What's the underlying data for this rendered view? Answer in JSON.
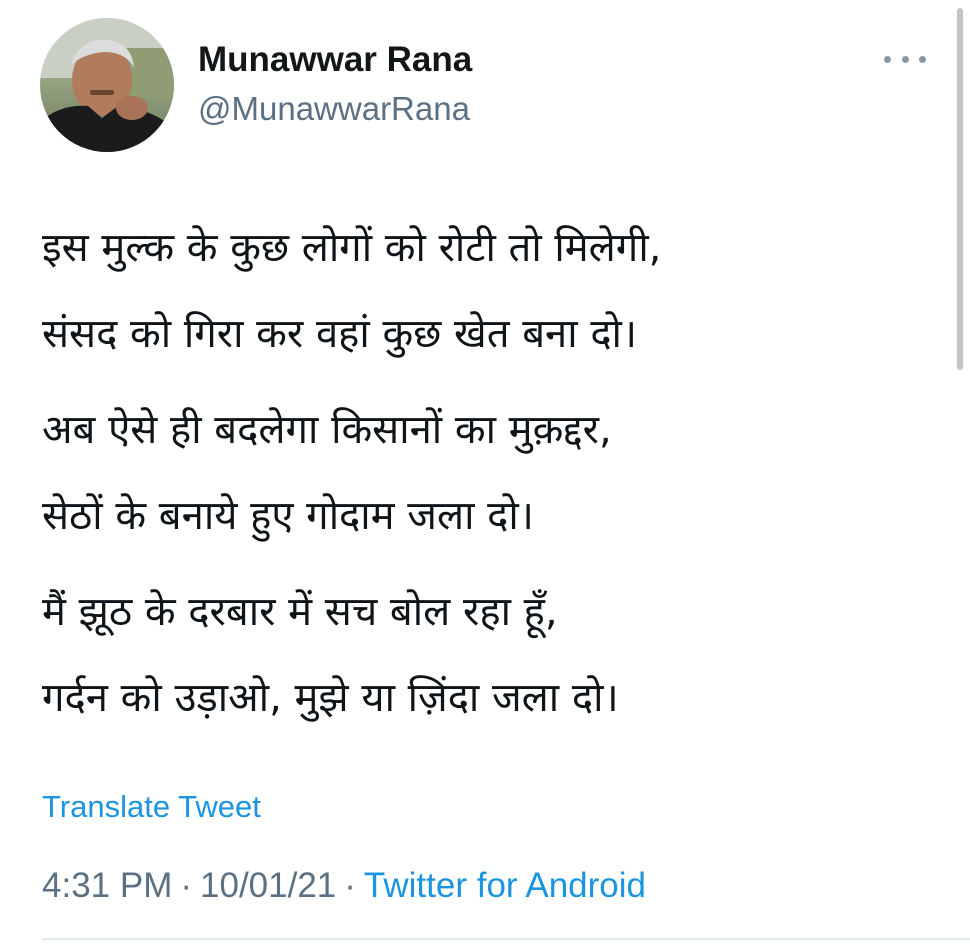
{
  "author": {
    "name": "Munawwar Rana",
    "handle": "@MunawwarRana",
    "avatar_icon": "profile-photo"
  },
  "tweet": {
    "stanzas": [
      [
        "इस मुल्क के कुछ लोगों को रोटी तो मिलेगी,",
        "संसद को गिरा कर वहां कुछ खेत बना दो।"
      ],
      [
        "अब ऐसे ही बदलेगा किसानों का मुक़द्दर,",
        "सेठों के बनाये हुए गोदाम जला दो।"
      ],
      [
        "मैं झूठ के दरबार में सच बोल रहा हूँ,",
        "गर्दन को उड़ाओ, मुझे या ज़िंदा जला दो।"
      ]
    ],
    "translate_label": "Translate Tweet"
  },
  "meta": {
    "time": "4:31 PM",
    "separator": "·",
    "date": "10/01/21",
    "source": "Twitter for Android"
  },
  "colors": {
    "link": "#1b95e0",
    "secondary_text": "#5b7083",
    "primary_text": "#0f1419"
  }
}
